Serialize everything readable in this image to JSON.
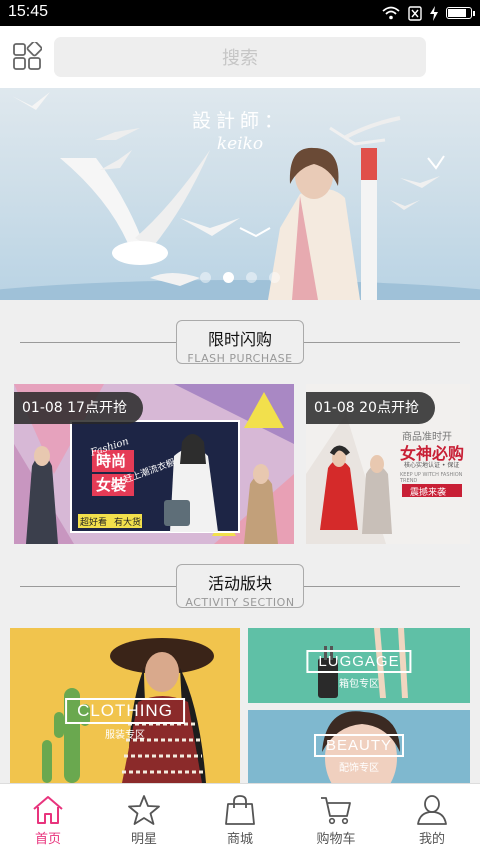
{
  "status_bar": {
    "time": "15:45",
    "battery_level": 0.85
  },
  "header": {
    "search_placeholder": "搜索"
  },
  "banner": {
    "title": "設計師：",
    "subtitle": "keiko",
    "slide_count": 4,
    "active_slide": 2
  },
  "flash_section": {
    "title": "限时闪购",
    "subtitle": "FLASH PURCHASE"
  },
  "flash_sales": [
    {
      "time_label": "01-08 17点开抢",
      "poster_script": "Fashion",
      "poster_title_1": "時尚",
      "poster_title_2": "女裝",
      "poster_side": "赶上潮流衣橱",
      "poster_tag_1": "超好看",
      "poster_tag_2": "有大货"
    },
    {
      "time_label": "01-08 20点开抢",
      "poster_top": "商品准时开",
      "poster_title": "女神必购",
      "poster_sub": "核心实地认证 • 保证",
      "poster_en": "KEEP UP WITCH FASHION TREND",
      "poster_cta": "震撼来袭"
    }
  ],
  "activity_section": {
    "title": "活动版块",
    "subtitle": "ACTIVITY SECTION"
  },
  "activity_tiles": [
    {
      "label_en": "CLOTHING",
      "label_zh": "服装专区"
    },
    {
      "label_en": "LUGGAGE",
      "label_zh": "箱包专区"
    },
    {
      "label_en": "BEAUTY",
      "label_zh": "配饰专区"
    }
  ],
  "nav": [
    {
      "label": "首页",
      "icon": "home-icon",
      "active": true
    },
    {
      "label": "明星",
      "icon": "star-icon",
      "active": false
    },
    {
      "label": "商城",
      "icon": "shopping-bag-icon",
      "active": false
    },
    {
      "label": "购物车",
      "icon": "cart-icon",
      "active": false
    },
    {
      "label": "我的",
      "icon": "user-icon",
      "active": false
    }
  ],
  "colors": {
    "accent": "#e8347d",
    "nav_inactive": "#555555",
    "badge_bg": "#282828"
  }
}
